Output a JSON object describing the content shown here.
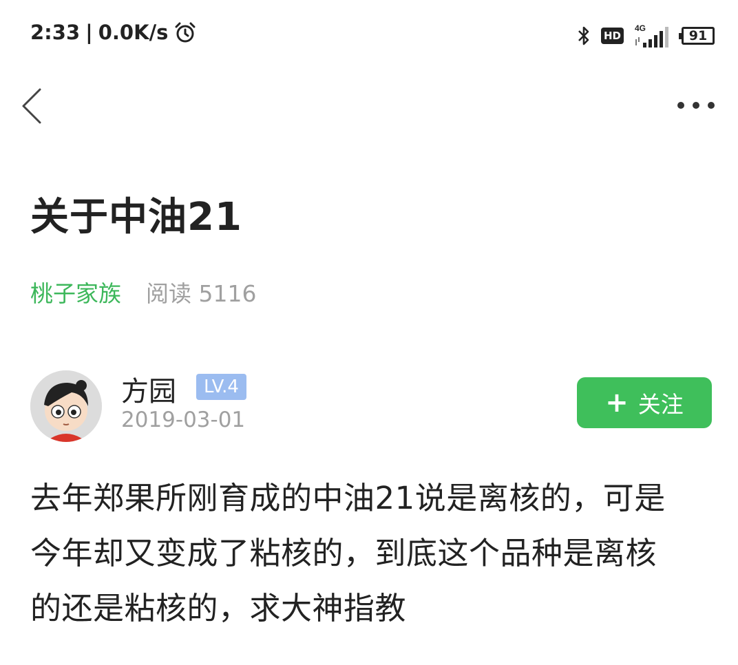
{
  "status_bar": {
    "time": "2:33",
    "separator": "|",
    "net_speed": "0.0K/s",
    "hd_label": "HD",
    "network_label": "4G",
    "battery_level": "91",
    "icons": [
      "alarm-icon",
      "bluetooth-icon",
      "hd-icon",
      "signal-icon",
      "battery-icon"
    ]
  },
  "nav": {
    "back_icon": "chevron-left-icon",
    "more_icon": "more-horizontal-icon"
  },
  "post": {
    "title": "关于中油21",
    "group": "桃子家族",
    "read_count": "阅读 5116",
    "author": {
      "name": "方园",
      "level": "LV.4",
      "date": "2019-03-01"
    },
    "follow": {
      "icon_text": "+",
      "label": "关注"
    },
    "content_lines": [
      "去年郑果所刚育成的中油21说是离核的，可是",
      "今年却又变成了粘核的，到底这个品种是离核",
      "的还是粘核的，求大神指教"
    ]
  },
  "colors": {
    "accent_green": "#3fbf5b",
    "group_link_green": "#3cb75a",
    "level_badge_blue": "#9bbcf0",
    "muted_gray": "#a0a0a0"
  }
}
